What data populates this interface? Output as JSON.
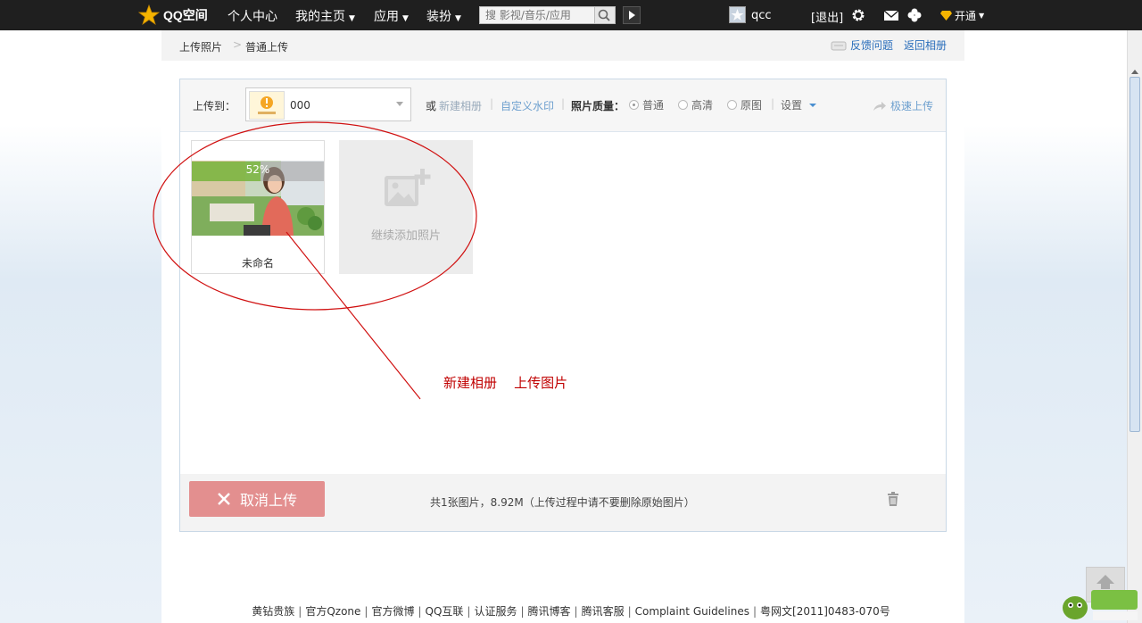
{
  "topnav": {
    "logo": "QQ空间",
    "items": [
      {
        "label": "个人中心",
        "has_caret": false
      },
      {
        "label": "我的主页",
        "has_caret": true
      },
      {
        "label": "应用",
        "has_caret": true
      },
      {
        "label": "装扮",
        "has_caret": true
      }
    ],
    "search_placeholder": "搜 影视/音乐/应用",
    "username": "qcc",
    "logout": "[退出]",
    "kaitong": "开通"
  },
  "breadcrumb": {
    "items": [
      "上传照片",
      "普通上传"
    ],
    "separator": ">"
  },
  "top_links": {
    "feedback": "反馈问题",
    "back": "返回相册"
  },
  "toolbar": {
    "upload_to_label": "上传到：",
    "album_name": "000",
    "or_label": "或",
    "new_album": "新建相册",
    "watermark": "自定义水印",
    "quality_label": "照片质量：",
    "quality_options": [
      "普通",
      "高清",
      "原图"
    ],
    "quality_selected": "普通",
    "settings": "设置",
    "fast_upload": "极速上传"
  },
  "photos": [
    {
      "name": "未命名",
      "progress_text": "52%",
      "progress": 0.52
    }
  ],
  "add_more": "继续添加照片",
  "annotation": "新建相册    上传图片",
  "footer_bar": {
    "cancel": "取消上传",
    "summary": "共1张图片，8.92M（上传过程中请不要删除原始图片）"
  },
  "page_footer": {
    "links": [
      "黄钻贵族",
      "官方Qzone",
      "官方微博",
      "QQ互联",
      "认证服务",
      "腾讯博客",
      "腾讯客服",
      "Complaint Guidelines",
      "粤网文[2011]0483-070号"
    ]
  },
  "colors": {
    "topbar": "#1f1f1f",
    "link": "#2a6ebb",
    "annotation": "#c00000",
    "cancel_button": "#e38f8f"
  }
}
